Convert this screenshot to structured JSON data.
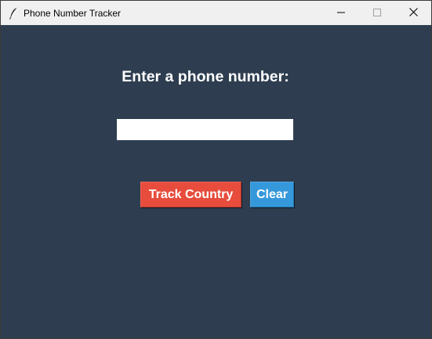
{
  "window": {
    "title": "Phone Number Tracker",
    "app_icon": "feather-icon",
    "controls": [
      "minimize-icon",
      "maximize-icon",
      "close-icon"
    ]
  },
  "main": {
    "prompt": "Enter a phone number:",
    "phone_input": {
      "value": "",
      "placeholder": ""
    },
    "buttons": {
      "track_label": "Track Country",
      "clear_label": "Clear"
    }
  },
  "colors": {
    "background": "#2e3e50",
    "track_button": "#e74c3c",
    "clear_button": "#3498db",
    "text": "#ffffff"
  }
}
